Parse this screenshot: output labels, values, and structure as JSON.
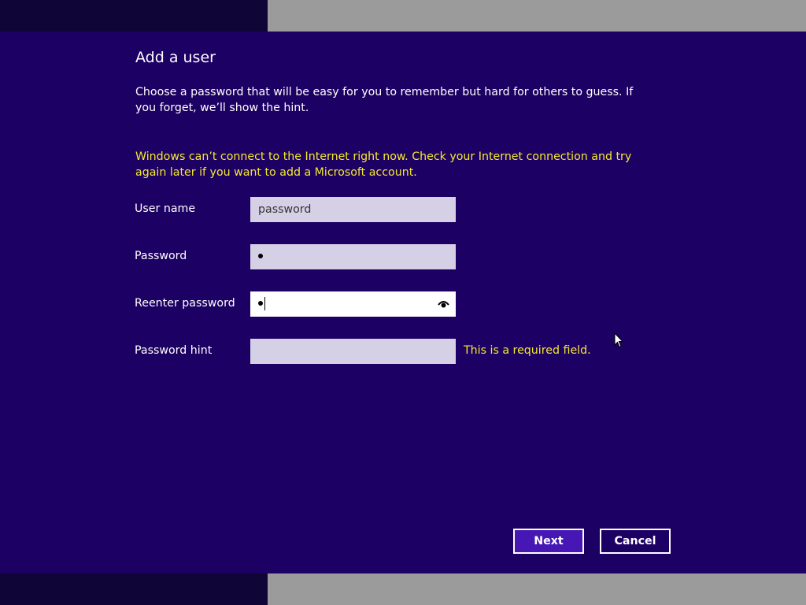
{
  "dialog": {
    "title": "Add a user",
    "instructions": "Choose a password that will be easy for you to remember but hard for others to guess. If you forget, we’ll show the hint.",
    "warning": "Windows can’t connect to the Internet right now. Check your Internet connection and try again later if you want to add a Microsoft account."
  },
  "form": {
    "username": {
      "label": "User name",
      "value": "password"
    },
    "password": {
      "label": "Password"
    },
    "reenter_password": {
      "label": "Reenter password",
      "reveal_icon": "eye-icon"
    },
    "password_hint": {
      "label": "Password hint",
      "value": "",
      "error": "This is a required field."
    }
  },
  "buttons": {
    "next": "Next",
    "cancel": "Cancel"
  },
  "colors": {
    "background": "#1d0064",
    "warning_text": "#f5e92e",
    "field_background": "#d6d0e6",
    "next_button": "#4617b4"
  }
}
